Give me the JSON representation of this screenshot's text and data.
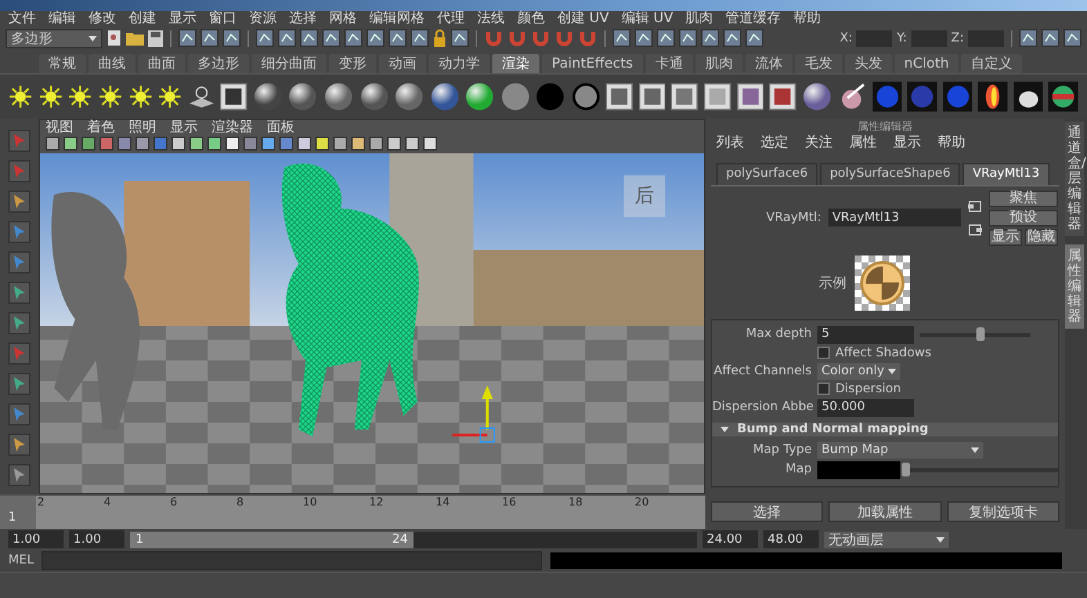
{
  "menu_bar": [
    "文件",
    "编辑",
    "修改",
    "创建",
    "显示",
    "窗口",
    "资源",
    "选择",
    "网格",
    "编辑网格",
    "代理",
    "法线",
    "颜色",
    "创建 UV",
    "编辑 UV",
    "肌肉",
    "管道缓存",
    "帮助"
  ],
  "status_line": {
    "mode": "多边形",
    "coords": [
      "X:",
      "Y:",
      "Z:"
    ]
  },
  "shelf_tabs": [
    {
      "label": "常规",
      "selected": false
    },
    {
      "label": "曲线",
      "selected": false
    },
    {
      "label": "曲面",
      "selected": false
    },
    {
      "label": "多边形",
      "selected": false
    },
    {
      "label": "细分曲面",
      "selected": false
    },
    {
      "label": "变形",
      "selected": false
    },
    {
      "label": "动画",
      "selected": false
    },
    {
      "label": "动力学",
      "selected": false
    },
    {
      "label": "渲染",
      "selected": true
    },
    {
      "label": "PaintEffects",
      "selected": false
    },
    {
      "label": "卡通",
      "selected": false
    },
    {
      "label": "肌肉",
      "selected": false
    },
    {
      "label": "流体",
      "selected": false
    },
    {
      "label": "毛发",
      "selected": false
    },
    {
      "label": "头发",
      "selected": false
    },
    {
      "label": "nCloth",
      "selected": false
    },
    {
      "label": "自定义",
      "selected": false
    }
  ],
  "viewport": {
    "menu": [
      "视图",
      "着色",
      "照明",
      "显示",
      "渲染器",
      "面板"
    ],
    "view_cube": "后"
  },
  "attribute_editor": {
    "title": "属性编辑器",
    "menu": [
      "列表",
      "选定",
      "关注",
      "属性",
      "显示",
      "帮助"
    ],
    "tabs": [
      {
        "label": "polySurface6",
        "selected": false
      },
      {
        "label": "polySurfaceShape6",
        "selected": false
      },
      {
        "label": "VRayMtl13",
        "selected": true
      }
    ],
    "material": {
      "label": "VRayMtl:",
      "value": "VRayMtl13"
    },
    "buttons": [
      "聚焦",
      "预设",
      "显示",
      "隐藏"
    ],
    "swatch_label": "示例",
    "attributes": [
      {
        "kind": "slider",
        "label": "Max depth",
        "value": "5",
        "level": 0.55
      },
      {
        "kind": "checkbox",
        "label": "Affect Shadows",
        "checked": false
      },
      {
        "kind": "dropdown",
        "label": "Affect Channels",
        "value": "Color only"
      },
      {
        "kind": "checkbox",
        "label": "Dispersion",
        "checked": false
      },
      {
        "kind": "field",
        "label": "Dispersion Abbe",
        "value": "50.000"
      }
    ],
    "section": {
      "title": "Bump and Normal mapping",
      "expanded": true
    },
    "section_attributes": [
      {
        "kind": "dropdown",
        "label": "Map Type",
        "value": "Bump Map"
      },
      {
        "kind": "color_slider",
        "label": "Map",
        "level": 0.0
      }
    ],
    "bottom_buttons": [
      "选择",
      "加载属性",
      "复制选项卡"
    ]
  },
  "side_tabs": [
    {
      "label": "通道盒/层编辑器",
      "selected": false
    },
    {
      "label": "属性编辑器",
      "selected": true
    }
  ],
  "timeline": {
    "current_frame": "1",
    "level": 0,
    "ticks": [
      "2",
      "4",
      "6",
      "8",
      "10",
      "12",
      "14",
      "16",
      "18",
      "20"
    ]
  },
  "range": {
    "start": "1.00",
    "playback_start": "1.00",
    "slider_start": "1",
    "slider_end": "24",
    "level": 0.5,
    "playback_end": "24.00",
    "end": "48.00",
    "anim_layer": "无动画层"
  },
  "command_line": {
    "label": "MEL"
  }
}
